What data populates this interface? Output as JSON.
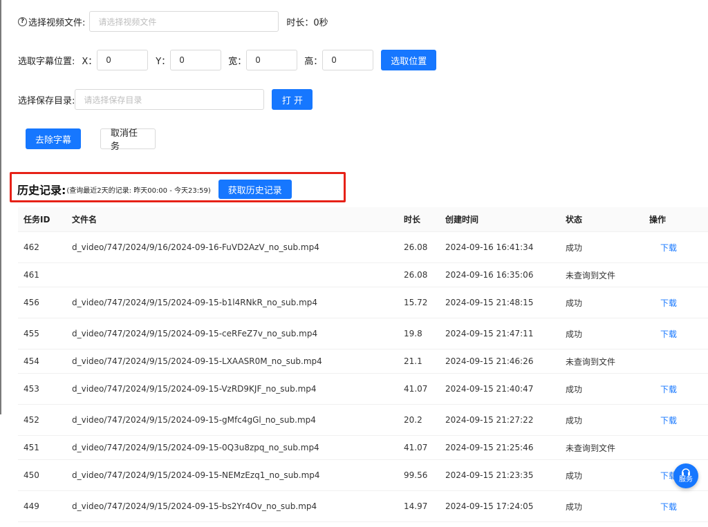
{
  "form": {
    "video_label": "选择视频文件:",
    "video_placeholder": "请选择视频文件",
    "duration_label": "时长：",
    "duration_value": "0秒",
    "position_label": "选取字幕位置:",
    "x_label": "X：",
    "x_value": "0",
    "y_label": "Y：",
    "y_value": "0",
    "w_label": "宽：",
    "w_value": "0",
    "h_label": "高：",
    "h_value": "0",
    "select_position_button": "选取位置",
    "save_dir_label": "选择保存目录:",
    "save_dir_placeholder": "请选择保存目录",
    "open_button": "打 开",
    "remove_subtitle_button": "去除字幕",
    "cancel_task_button": "取消任务"
  },
  "history": {
    "title": "历史记录:",
    "subtitle": "(查询最近2天的记录: 昨天00:00 - 今天23:59)",
    "fetch_button": "获取历史记录",
    "columns": [
      "任务ID",
      "文件名",
      "时长",
      "创建时间",
      "状态",
      "操作"
    ],
    "rows": [
      {
        "id": "462",
        "name": "d_video/747/2024/9/16/2024-09-16-FuVD2AzV_no_sub.mp4",
        "dur": "26.08",
        "time": "2024-09-16 16:41:34",
        "status": "成功",
        "action": "下载"
      },
      {
        "id": "461",
        "name": "",
        "dur": "26.08",
        "time": "2024-09-16 16:35:06",
        "status": "未查询到文件",
        "action": ""
      },
      {
        "id": "456",
        "name": "d_video/747/2024/9/15/2024-09-15-b1l4RNkR_no_sub.mp4",
        "dur": "15.72",
        "time": "2024-09-15 21:48:15",
        "status": "成功",
        "action": "下载"
      },
      {
        "id": "455",
        "name": "d_video/747/2024/9/15/2024-09-15-ceRFeZ7v_no_sub.mp4",
        "dur": "19.8",
        "time": "2024-09-15 21:47:11",
        "status": "成功",
        "action": "下载"
      },
      {
        "id": "454",
        "name": "d_video/747/2024/9/15/2024-09-15-LXAASR0M_no_sub.mp4",
        "dur": "21.1",
        "time": "2024-09-15 21:46:26",
        "status": "未查询到文件",
        "action": ""
      },
      {
        "id": "453",
        "name": "d_video/747/2024/9/15/2024-09-15-VzRD9KJF_no_sub.mp4",
        "dur": "41.07",
        "time": "2024-09-15 21:40:47",
        "status": "成功",
        "action": "下载"
      },
      {
        "id": "452",
        "name": "d_video/747/2024/9/15/2024-09-15-gMfc4gGl_no_sub.mp4",
        "dur": "20.2",
        "time": "2024-09-15 21:27:22",
        "status": "成功",
        "action": "下载"
      },
      {
        "id": "451",
        "name": "d_video/747/2024/9/15/2024-09-15-0Q3u8zpq_no_sub.mp4",
        "dur": "41.07",
        "time": "2024-09-15 21:25:46",
        "status": "未查询到文件",
        "action": ""
      },
      {
        "id": "450",
        "name": "d_video/747/2024/9/15/2024-09-15-NEMzEzq1_no_sub.mp4",
        "dur": "99.56",
        "time": "2024-09-15 21:23:35",
        "status": "成功",
        "action": "下载"
      },
      {
        "id": "449",
        "name": "d_video/747/2024/9/15/2024-09-15-bs2Yr4Ov_no_sub.mp4",
        "dur": "14.97",
        "time": "2024-09-15 17:24:05",
        "status": "成功",
        "action": "下载"
      }
    ]
  },
  "service": {
    "icon": "headset-icon",
    "label": "服务"
  },
  "colors": {
    "primary": "#1677ff",
    "highlight_border": "#e62117"
  }
}
